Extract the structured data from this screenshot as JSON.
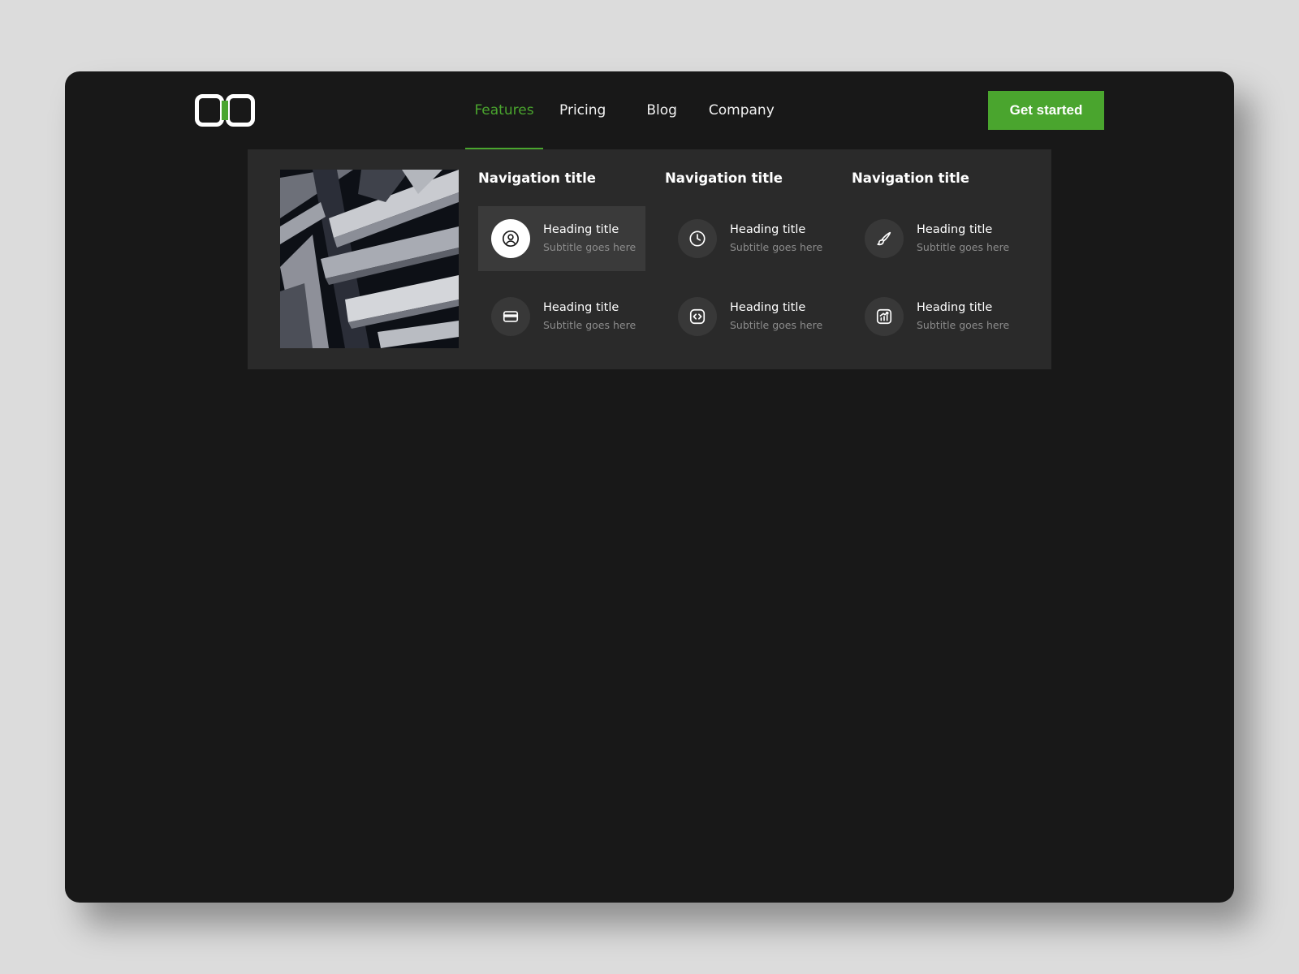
{
  "header": {
    "logo": {
      "icon": "logo-icon",
      "accent_color": "#4aa52e"
    },
    "nav": [
      {
        "label": "Features",
        "active": true
      },
      {
        "label": "Pricing",
        "active": false
      },
      {
        "label": "Blog",
        "active": false
      },
      {
        "label": "Company",
        "active": false
      }
    ],
    "cta_label": "Get started"
  },
  "mega_menu": {
    "image": {
      "description_icon": "abstract-architecture-image"
    },
    "columns": [
      {
        "title": "Navigation title",
        "items": [
          {
            "heading": "Heading title",
            "subtitle": "Subtitle goes here",
            "icon": "user-circle-icon",
            "selected": true
          },
          {
            "heading": "Heading title",
            "subtitle": "Subtitle goes here",
            "icon": "credit-card-icon",
            "selected": false
          }
        ]
      },
      {
        "title": "Navigation title",
        "items": [
          {
            "heading": "Heading title",
            "subtitle": "Subtitle goes here",
            "icon": "clock-icon",
            "selected": false
          },
          {
            "heading": "Heading title",
            "subtitle": "Subtitle goes here",
            "icon": "code-icon",
            "selected": false
          }
        ]
      },
      {
        "title": "Navigation title",
        "items": [
          {
            "heading": "Heading title",
            "subtitle": "Subtitle goes here",
            "icon": "brush-icon",
            "selected": false
          },
          {
            "heading": "Heading title",
            "subtitle": "Subtitle goes here",
            "icon": "chart-icon",
            "selected": false
          }
        ]
      }
    ]
  },
  "colors": {
    "accent": "#4aa52e",
    "window_bg": "#181818",
    "panel_bg": "#2a2a2a",
    "page_bg": "#dcdcdc"
  }
}
